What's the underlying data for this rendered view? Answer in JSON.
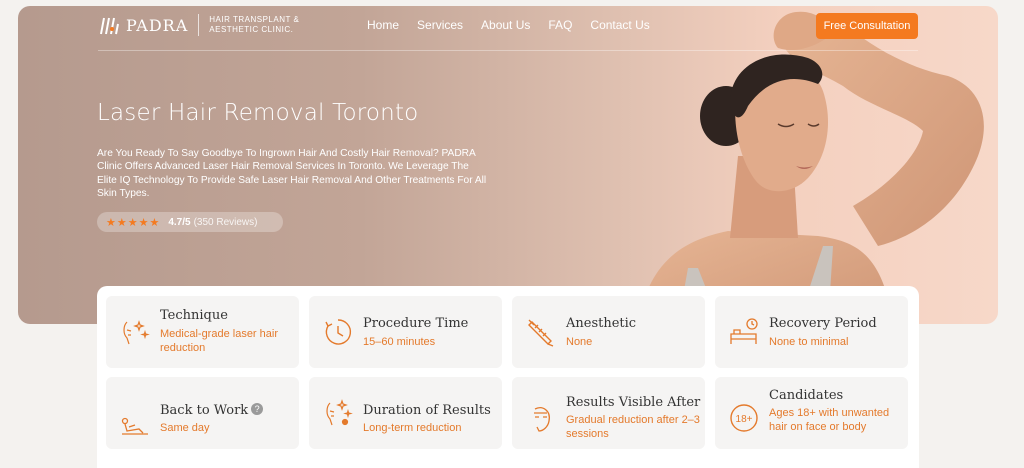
{
  "brand": {
    "name": "PADRA",
    "tagline": "HAIR TRANSPLANT & AESTHETIC CLINIC."
  },
  "nav": {
    "items": [
      {
        "label": "Home"
      },
      {
        "label": "Services"
      },
      {
        "label": "About Us"
      },
      {
        "label": "FAQ"
      },
      {
        "label": "Contact Us"
      }
    ],
    "cta": "Free Consultation"
  },
  "hero": {
    "title": "Laser Hair Removal Toronto",
    "description": "Are You Ready To Say Goodbye To Ingrown Hair And Costly Hair Removal? PADRA Clinic Offers Advanced Laser Hair Removal Services In Toronto. We Leverage The Elite IQ Technology To Provide Safe Laser Hair Removal And Other Treatments For All Skin Types.",
    "rating": {
      "stars": "★★★★★",
      "score": "4.7/5",
      "count": "(350 Reviews)",
      "value": 4.7
    }
  },
  "cards": [
    {
      "title": "Technique",
      "value": "Medical-grade laser hair reduction",
      "icon": "face-sparkle-icon"
    },
    {
      "title": "Procedure Time",
      "value": "15–60 minutes",
      "icon": "clock-icon"
    },
    {
      "title": "Anesthetic",
      "value": "None",
      "icon": "syringe-icon"
    },
    {
      "title": "Recovery Period",
      "value": "None to minimal",
      "icon": "bed-clock-icon"
    },
    {
      "title": "Back to Work",
      "value": "Same day",
      "icon": "reclining-person-icon",
      "help": "?"
    },
    {
      "title": "Duration of Results",
      "value": "Long-term reduction",
      "icon": "face-sparkle-icon"
    },
    {
      "title": "Results Visible After",
      "value": "Gradual reduction after 2–3 sessions",
      "icon": "face-profile-icon"
    },
    {
      "title": "Candidates",
      "value": "Ages 18+ with unwanted hair on face or body",
      "icon": "age-18-plus-icon",
      "badge": "18+"
    }
  ],
  "colors": {
    "accent": "#f47a20",
    "card_value": "#e47a2c",
    "card_bg": "#f5f4f3"
  }
}
